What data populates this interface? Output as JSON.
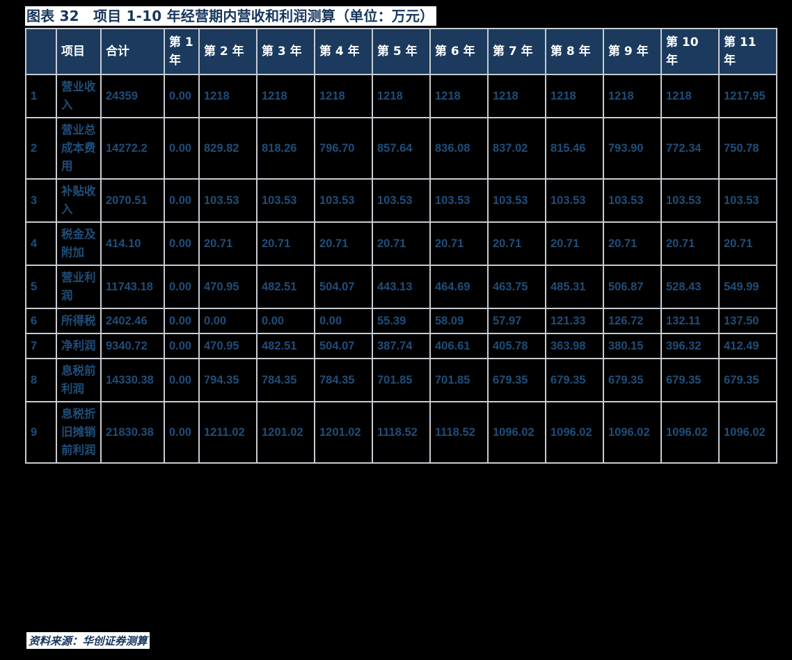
{
  "title": {
    "text": "图表 32　项目 1-10 年经营期内营收和利润测算（单位：万元）"
  },
  "colors": {
    "header_bg": "#1b3a5e",
    "body_bg": "#000000",
    "grid": "#c9ccd3",
    "text_blue": "#1f4e79",
    "title_blue": "#17365d",
    "header_text": "#ffffff"
  },
  "table": {
    "headers": [
      "",
      "项目",
      "合计",
      "第 1 年",
      "第 2 年",
      "第 3 年",
      "第 4 年",
      "第 5 年",
      "第 6 年",
      "第 7 年",
      "第 8 年",
      "第 9 年",
      "第 10 年",
      "第 11 年"
    ],
    "rows": [
      {
        "index": "1",
        "item": "营业收入",
        "total": "24359",
        "years": [
          "0.00",
          "1218",
          "1218",
          "1218",
          "1218",
          "1218",
          "1218",
          "1218",
          "1218",
          "1218",
          "1217.95"
        ]
      },
      {
        "index": "2",
        "item": "营业总成本费用",
        "total": "14272.2",
        "years": [
          "0.00",
          "829.82",
          "818.26",
          "796.70",
          "857.64",
          "836.08",
          "837.02",
          "815.46",
          "793.90",
          "772.34",
          "750.78"
        ]
      },
      {
        "index": "3",
        "item": "补贴收入",
        "total": "2070.51",
        "years": [
          "0.00",
          "103.53",
          "103.53",
          "103.53",
          "103.53",
          "103.53",
          "103.53",
          "103.53",
          "103.53",
          "103.53",
          "103.53"
        ]
      },
      {
        "index": "4",
        "item": "税金及附加",
        "total": "414.10",
        "years": [
          "0.00",
          "20.71",
          "20.71",
          "20.71",
          "20.71",
          "20.71",
          "20.71",
          "20.71",
          "20.71",
          "20.71",
          "20.71"
        ]
      },
      {
        "index": "5",
        "item": "营业利润",
        "total": "11743.18",
        "years": [
          "0.00",
          "470.95",
          "482.51",
          "504.07",
          "443.13",
          "464.69",
          "463.75",
          "485.31",
          "506.87",
          "528.43",
          "549.99"
        ]
      },
      {
        "index": "6",
        "item": "所得税",
        "total": "2402.46",
        "years": [
          "0.00",
          "0.00",
          "0.00",
          "0.00",
          "55.39",
          "58.09",
          "57.97",
          "121.33",
          "126.72",
          "132.11",
          "137.50"
        ]
      },
      {
        "index": "7",
        "item": "净利润",
        "total": "9340.72",
        "years": [
          "0.00",
          "470.95",
          "482.51",
          "504.07",
          "387.74",
          "406.61",
          "405.78",
          "363.98",
          "380.15",
          "396.32",
          "412.49"
        ]
      },
      {
        "index": "8",
        "item": "息税前利润",
        "total": "14330.38",
        "years": [
          "0.00",
          "794.35",
          "784.35",
          "784.35",
          "701.85",
          "701.85",
          "679.35",
          "679.35",
          "679.35",
          "679.35",
          "679.35"
        ]
      },
      {
        "index": "9",
        "item": "息税折旧摊销前利润",
        "total": "21830.38",
        "years": [
          "0.00",
          "1211.02",
          "1201.02",
          "1201.02",
          "1118.52",
          "1118.52",
          "1096.02",
          "1096.02",
          "1096.02",
          "1096.02",
          "1096.02"
        ]
      }
    ]
  },
  "source": {
    "text": "资料来源：华创证券测算"
  }
}
